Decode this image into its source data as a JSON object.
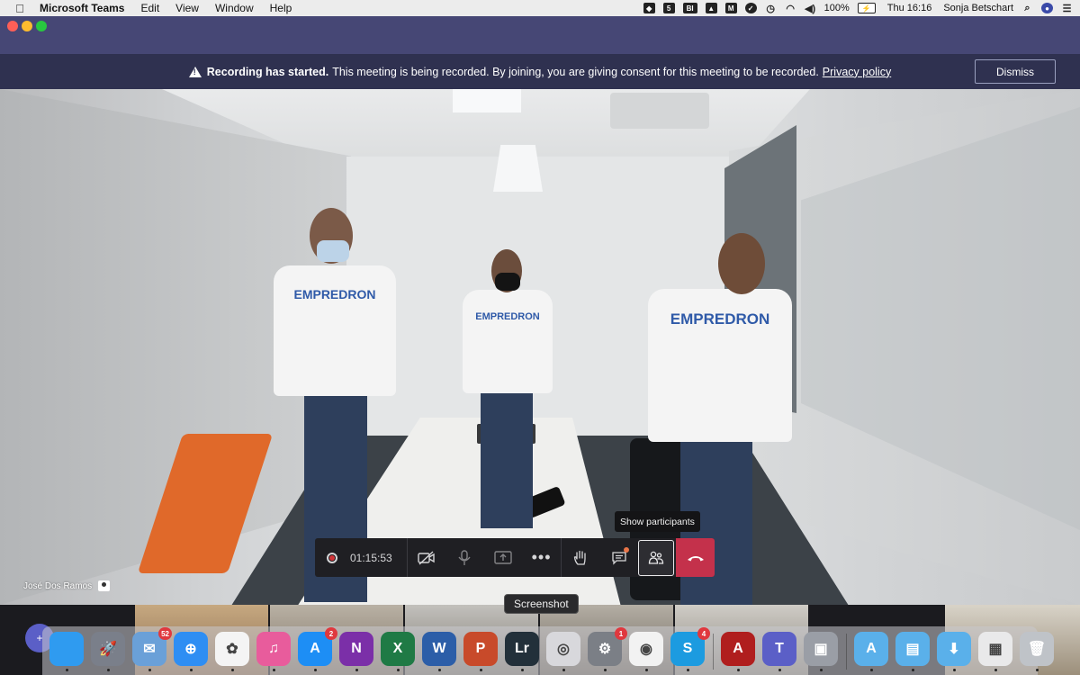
{
  "menubar": {
    "app_name": "Microsoft Teams",
    "menus": [
      "Edit",
      "View",
      "Window",
      "Help"
    ],
    "battery": "100%",
    "clock": "Thu 16:16",
    "user": "Sonja Betschart",
    "status_icons": [
      "dropbox-icon",
      "5",
      "BI",
      "triangle-icon",
      "malwarebytes-icon",
      "check-icon",
      "time-machine-icon",
      "wifi-icon",
      "volume-icon",
      "battery-icon",
      "search-icon",
      "siri-icon",
      "control-center-icon"
    ]
  },
  "banner": {
    "strong": "Recording has started.",
    "text": "This meeting is being recorded. By joining, you are giving consent for this meeting to be recorded.",
    "link": "Privacy policy",
    "dismiss": "Dismiss"
  },
  "video": {
    "participant_name": "José Dos Ramos",
    "shirt_text": "EMPREDRON"
  },
  "controls": {
    "timer": "01:15:53",
    "tooltip": "Show participants"
  },
  "dock": {
    "tooltip": "Screenshot",
    "apps": [
      {
        "name": "finder",
        "label": "",
        "color": "#2f9bf0",
        "badge": ""
      },
      {
        "name": "launchpad",
        "label": "🚀",
        "color": "#7a7f8a",
        "badge": ""
      },
      {
        "name": "mail",
        "label": "✉",
        "color": "#6aa0d8",
        "badge": "52"
      },
      {
        "name": "safari",
        "label": "⊕",
        "color": "#2e8ef3",
        "badge": ""
      },
      {
        "name": "photos",
        "label": "✿",
        "color": "#f4f4f4",
        "badge": ""
      },
      {
        "name": "itunes",
        "label": "♫",
        "color": "#e85c9c",
        "badge": ""
      },
      {
        "name": "app-store",
        "label": "A",
        "color": "#1d8ef5",
        "badge": "2"
      },
      {
        "name": "onenote",
        "label": "N",
        "color": "#7b2fa8",
        "badge": ""
      },
      {
        "name": "excel",
        "label": "X",
        "color": "#1f7a45",
        "badge": ""
      },
      {
        "name": "word",
        "label": "W",
        "color": "#2c5ea8",
        "badge": ""
      },
      {
        "name": "powerpoint",
        "label": "P",
        "color": "#c84a2a",
        "badge": ""
      },
      {
        "name": "lightroom",
        "label": "Lr",
        "color": "#22303a",
        "badge": ""
      },
      {
        "name": "screenshot",
        "label": "◎",
        "color": "#d8d8dc",
        "badge": ""
      },
      {
        "name": "system-preferences",
        "label": "⚙",
        "color": "#7b7f86",
        "badge": "1"
      },
      {
        "name": "chrome",
        "label": "◉",
        "color": "#f2f2f2",
        "badge": ""
      },
      {
        "name": "skype",
        "label": "S",
        "color": "#1c9be0",
        "badge": "4"
      },
      {
        "name": "acrobat",
        "label": "A",
        "color": "#b01e1e",
        "badge": ""
      },
      {
        "name": "teams",
        "label": "T",
        "color": "#5b5fc7",
        "badge": ""
      },
      {
        "name": "preview",
        "label": "▣",
        "color": "#9a9ea6",
        "badge": ""
      },
      {
        "name": "applications-folder",
        "label": "A",
        "color": "#5ab0ea",
        "badge": ""
      },
      {
        "name": "documents-folder",
        "label": "▤",
        "color": "#5ab0ea",
        "badge": ""
      },
      {
        "name": "downloads-folder",
        "label": "⬇",
        "color": "#5ab0ea",
        "badge": ""
      },
      {
        "name": "presentation-stack",
        "label": "▦",
        "color": "#e9e9ea",
        "badge": ""
      },
      {
        "name": "trash",
        "label": "🗑",
        "color": "#bfc3c8",
        "badge": ""
      }
    ]
  },
  "colors": {
    "teams_purple": "#464775",
    "banner_bg": "#2f3150",
    "hangup_red": "#c4314b",
    "record_red": "#d13438"
  }
}
